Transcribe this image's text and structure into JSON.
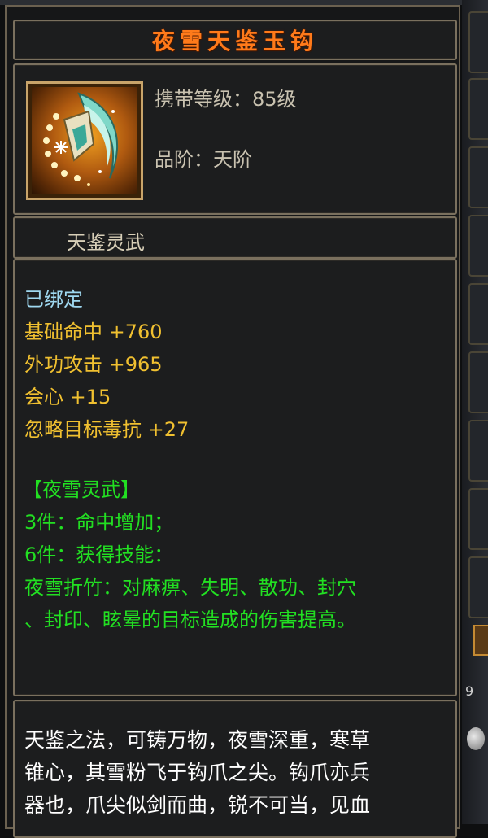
{
  "item": {
    "name": "夜雪天鉴玉钩",
    "carry_level": "携带等级：85级",
    "grade": "品阶：天阶",
    "sub_name": "天鉴灵武",
    "icon": "jade-hook-weapon-icon"
  },
  "stats": {
    "bound": "已绑定",
    "lines": [
      "基础命中 +760",
      "外功攻击 +965",
      "会心 +15",
      "忽略目标毒抗 +27"
    ]
  },
  "set": {
    "name": "【夜雪灵武】",
    "lines": [
      "3件：命中增加；",
      "6件：获得技能：",
      "夜雪折竹：对麻痹、失明、散功、封穴",
      "、封印、眩晕的目标造成的伤害提高。"
    ]
  },
  "description": {
    "lines": [
      "天鉴之法，可铸万物，夜雪深重，寒草",
      "锥心，其雪粉飞于钩爪之尖。钩爪亦兵",
      "器也，爪尖似剑而曲，锐不可当，见血"
    ]
  },
  "background": {
    "partial_text": "9"
  },
  "colors": {
    "title": "#ff7a1a",
    "bound": "#9fd8f0",
    "stat": "#f0c030",
    "set": "#22e022",
    "description": "#ffffff",
    "border": "#7a705e"
  }
}
